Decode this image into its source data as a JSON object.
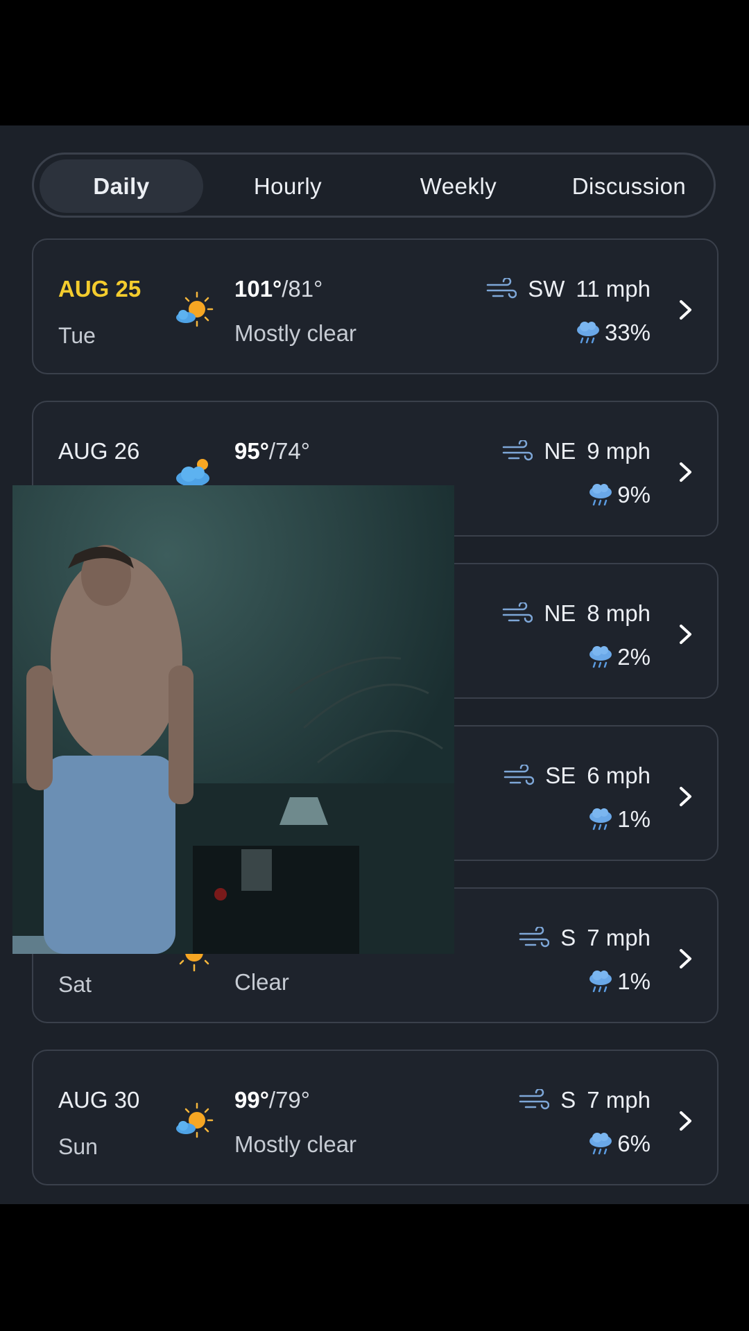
{
  "tabs": [
    "Daily",
    "Hourly",
    "Weekly",
    "Discussion"
  ],
  "active_tab": "Daily",
  "colors": {
    "background": "#1c2129",
    "today_accent": "#f4cc2e",
    "card_border": "#3a404b",
    "icon_blue": "#7ea7d8"
  },
  "days": [
    {
      "date": "AUG 25",
      "dow": "Tue",
      "hi": "101°",
      "lo": "/81°",
      "cond": "Mostly clear",
      "wind_dir": "SW",
      "wind_speed": "11 mph",
      "precip": "33%",
      "icon": "sun-cloud-icon",
      "today": true
    },
    {
      "date": "AUG 26",
      "dow": "",
      "hi": "95°",
      "lo": "/74°",
      "cond": "",
      "wind_dir": "NE",
      "wind_speed": "9 mph",
      "precip": "9%",
      "icon": "cloud-sun-icon",
      "today": false
    },
    {
      "date": "",
      "dow": "",
      "hi": "",
      "lo": "",
      "cond": "",
      "wind_dir": "NE",
      "wind_speed": "8 mph",
      "precip": "2%",
      "icon": "",
      "today": false
    },
    {
      "date": "",
      "dow": "",
      "hi": "",
      "lo": "",
      "cond": "",
      "wind_dir": "SE",
      "wind_speed": "6 mph",
      "precip": "1%",
      "icon": "",
      "today": false
    },
    {
      "date": "",
      "dow": "Sat",
      "hi": "",
      "lo": "",
      "cond": "Clear",
      "wind_dir": "S",
      "wind_speed": "7 mph",
      "precip": "1%",
      "icon": "sun-icon",
      "today": false
    },
    {
      "date": "AUG 30",
      "dow": "Sun",
      "hi": "99°",
      "lo": "/79°",
      "cond": "Mostly clear",
      "wind_dir": "S",
      "wind_speed": "7 mph",
      "precip": "6%",
      "icon": "sun-cloud-icon",
      "today": false
    }
  ],
  "video_overlay": {
    "content": "video-frame"
  }
}
